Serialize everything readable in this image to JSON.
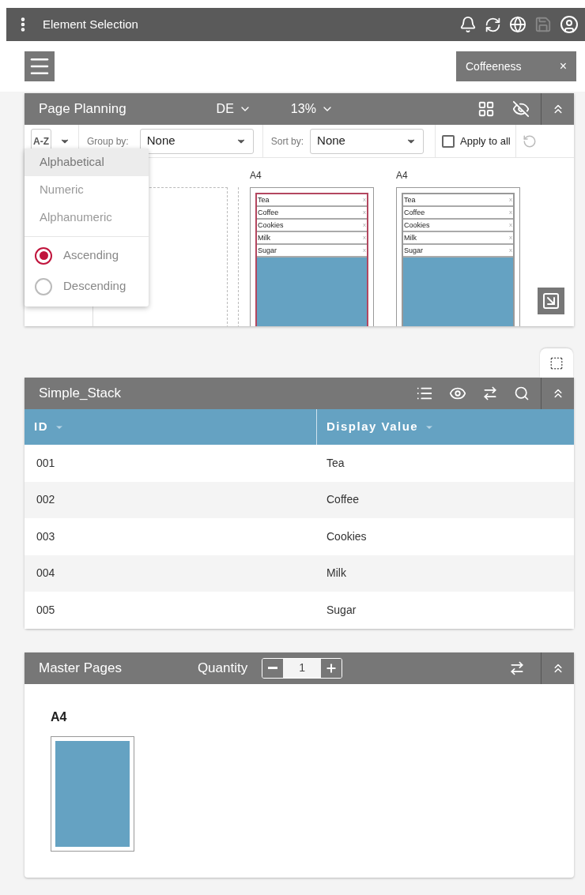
{
  "app_bar": {
    "title": "Element Selection"
  },
  "context_chip": {
    "label": "Coffeeness",
    "close": "×"
  },
  "page_planning": {
    "title": "Page Planning",
    "language": "DE",
    "zoom": "13%",
    "sort_toggle": "A-Z",
    "group_by": {
      "label": "Group by:",
      "value": "None"
    },
    "sort_by": {
      "label": "Sort by:",
      "value": "None"
    },
    "apply_to_all": {
      "label": "Apply to all",
      "checked": false
    },
    "sort_menu": {
      "modes": [
        {
          "label": "Alphabetical",
          "selected": true
        },
        {
          "label": "Numeric",
          "selected": false
        },
        {
          "label": "Alphanumeric",
          "selected": false
        }
      ],
      "orders": [
        {
          "label": "Ascending",
          "selected": true
        },
        {
          "label": "Descending",
          "selected": false
        }
      ]
    },
    "pages": [
      {
        "label": "A4",
        "selected": true,
        "items": [
          {
            "label": "Tea",
            "remove": "x"
          },
          {
            "label": "Coffee",
            "remove": "x"
          },
          {
            "label": "Cookies",
            "remove": "x"
          },
          {
            "label": "Milk",
            "remove": "x"
          },
          {
            "label": "Sugar",
            "remove": "x"
          }
        ]
      },
      {
        "label": "A4",
        "selected": false,
        "items": [
          {
            "label": "Tea",
            "remove": "x"
          },
          {
            "label": "Coffee",
            "remove": "x"
          },
          {
            "label": "Cookies",
            "remove": "x"
          },
          {
            "label": "Milk",
            "remove": "x"
          },
          {
            "label": "Sugar",
            "remove": "x"
          }
        ]
      }
    ]
  },
  "simple_stack": {
    "title": "Simple_Stack",
    "columns": [
      "ID",
      "Display Value"
    ],
    "rows": [
      [
        "001",
        "Tea"
      ],
      [
        "002",
        "Coffee"
      ],
      [
        "003",
        "Cookies"
      ],
      [
        "004",
        "Milk"
      ],
      [
        "005",
        "Sugar"
      ]
    ]
  },
  "master_pages": {
    "title": "Master Pages",
    "quantity_label": "Quantity",
    "quantity": "1",
    "pages": [
      {
        "label": "A4"
      }
    ]
  }
}
